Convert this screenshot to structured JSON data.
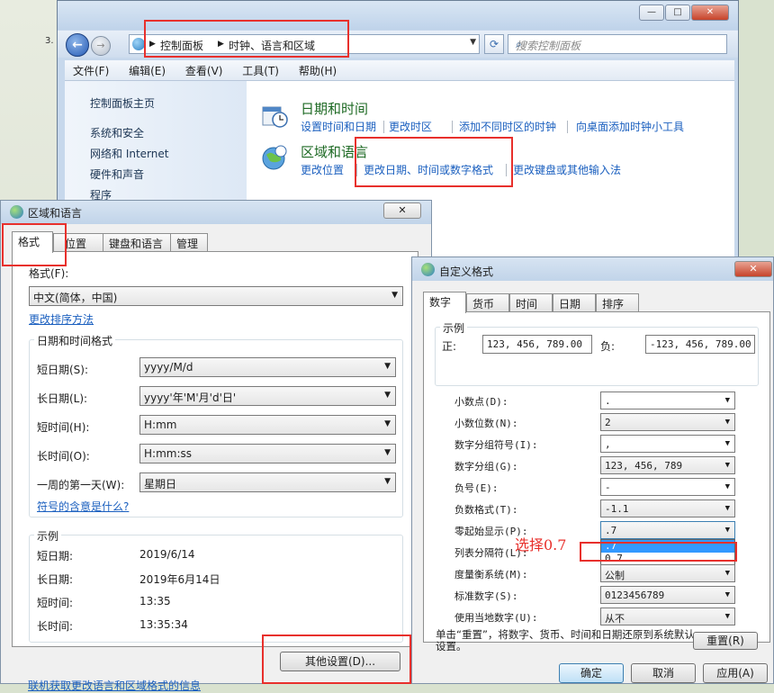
{
  "background": {
    "number_text": "3. ("
  },
  "control_panel": {
    "breadcrumb": [
      "控制面板",
      "时钟、语言和区域"
    ],
    "search_placeholder": "搜索控制面板",
    "menu": [
      "文件(F)",
      "编辑(E)",
      "查看(V)",
      "工具(T)",
      "帮助(H)"
    ],
    "sidebar": [
      "控制面板主页",
      "系统和安全",
      "网络和 Internet",
      "硬件和声音",
      "程序"
    ],
    "categories": [
      {
        "title": "日期和时间",
        "links": [
          "设置时间和日期",
          "更改时区",
          "添加不同时区的时钟",
          "向桌面添加时钟小工具"
        ]
      },
      {
        "title": "区域和语言",
        "links": [
          "更改位置",
          "更改日期、时间或数字格式",
          "更改键盘或其他输入法"
        ]
      }
    ]
  },
  "region_dialog": {
    "title": "区域和语言",
    "tabs": [
      "格式",
      "位置",
      "键盘和语言",
      "管理"
    ],
    "format_label": "格式(F):",
    "format_value": "中文(简体，中国)",
    "sort_link": "更改排序方法",
    "datetime_group": "日期和时间格式",
    "rows": [
      {
        "label": "短日期(S):",
        "value": "yyyy/M/d"
      },
      {
        "label": "长日期(L):",
        "value": "yyyy'年'M'月'd'日'"
      },
      {
        "label": "短时间(H):",
        "value": "H:mm"
      },
      {
        "label": "长时间(O):",
        "value": "H:mm:ss"
      },
      {
        "label": "一周的第一天(W):",
        "value": "星期日"
      }
    ],
    "symbol_link": "符号的含意是什么?",
    "example_group": "示例",
    "examples": [
      {
        "label": "短日期:",
        "value": "2019/6/14"
      },
      {
        "label": "长日期:",
        "value": "2019年6月14日"
      },
      {
        "label": "短时间:",
        "value": "13:35"
      },
      {
        "label": "长时间:",
        "value": "13:35:34"
      }
    ],
    "other_settings": "其他设置(D)...",
    "footer_link": "联机获取更改语言和区域格式的信息"
  },
  "custom_dialog": {
    "title": "自定义格式",
    "tabs": [
      "数字",
      "货币",
      "时间",
      "日期",
      "排序"
    ],
    "example_group": "示例",
    "positive_label": "正:",
    "positive_value": "123, 456, 789.00",
    "negative_label": "负:",
    "negative_value": "-123, 456, 789.00",
    "rows": [
      {
        "label": "小数点(D):",
        "value": "."
      },
      {
        "label": "小数位数(N):",
        "value": "2"
      },
      {
        "label": "数字分组符号(I):",
        "value": ","
      },
      {
        "label": "数字分组(G):",
        "value": "123, 456, 789"
      },
      {
        "label": "负号(E):",
        "value": "-"
      },
      {
        "label": "负数格式(T):",
        "value": "-1.1"
      },
      {
        "label": "零起始显示(P):",
        "value": ".7"
      },
      {
        "label": "列表分隔符(L):",
        "value": ""
      },
      {
        "label": "度量衡系统(M):",
        "value": "公制"
      },
      {
        "label": "标准数字(S):",
        "value": "0123456789"
      },
      {
        "label": "使用当地数字(U):",
        "value": "从不"
      }
    ],
    "dropdown_options": [
      ".7",
      "0.7"
    ],
    "reset_note": "单击“重置”，将数字、货币、时间和日期还原到系统默认设置。",
    "reset_button": "重置(R)",
    "ok": "确定",
    "cancel": "取消",
    "apply": "应用(A)"
  },
  "annotation": {
    "text": "选择0.7",
    "color": "#e8302c"
  }
}
